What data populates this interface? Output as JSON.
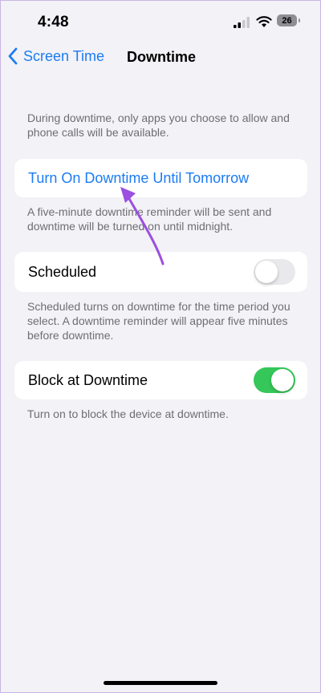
{
  "status_bar": {
    "time": "4:48",
    "battery": "26"
  },
  "nav": {
    "back_label": "Screen Time",
    "title": "Downtime"
  },
  "intro_text": "During downtime, only apps you choose to allow and phone calls will be available.",
  "turn_on": {
    "label": "Turn On Downtime Until Tomorrow",
    "footer": "A five-minute downtime reminder will be sent and downtime will be turned on until midnight."
  },
  "scheduled": {
    "label": "Scheduled",
    "enabled": false,
    "footer": "Scheduled turns on downtime for the time period you select. A downtime reminder will appear five minutes before downtime."
  },
  "block": {
    "label": "Block at Downtime",
    "enabled": true,
    "footer": "Turn on to block the device at downtime."
  },
  "colors": {
    "accent": "#1c7cf4",
    "toggle_on": "#35c759",
    "annotation_arrow": "#9b4fe0"
  }
}
